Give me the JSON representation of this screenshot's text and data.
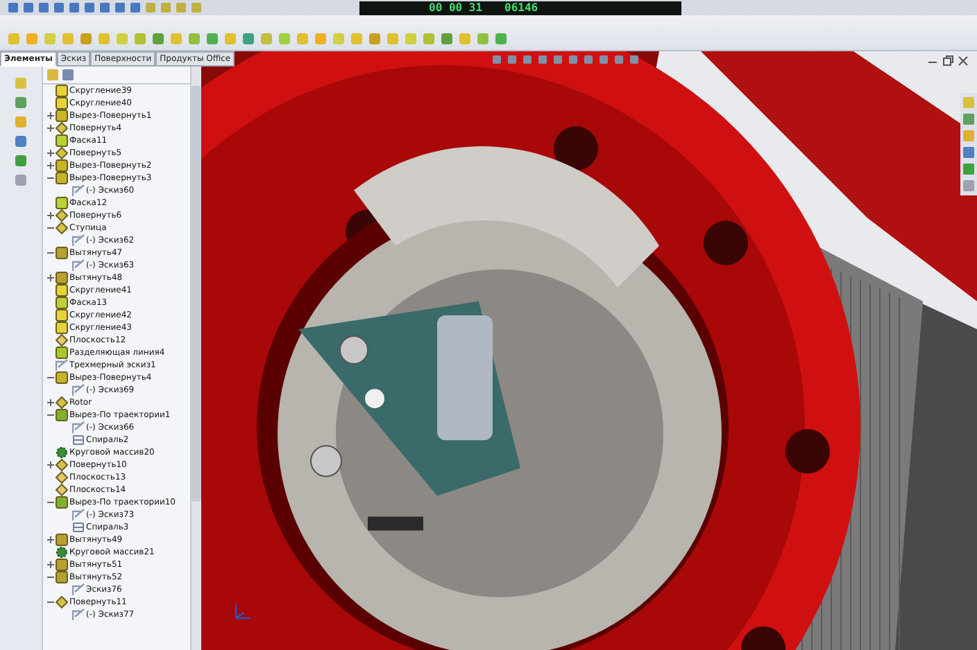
{
  "timer": {
    "time": "00 00 31",
    "count": "06146"
  },
  "tabs": [
    {
      "label": "Элементы",
      "selected": true
    },
    {
      "label": "Эскиз",
      "selected": false
    },
    {
      "label": "Поверхности",
      "selected": false
    },
    {
      "label": "Продукты Office",
      "selected": false
    }
  ],
  "tree": [
    {
      "label": "Скругление39",
      "kind": "fillet"
    },
    {
      "label": "Скругление40",
      "kind": "fillet"
    },
    {
      "label": "Вырез-Повернуть1",
      "kind": "cut",
      "expanded": false
    },
    {
      "label": "Повернуть4",
      "kind": "revolve",
      "expanded": false
    },
    {
      "label": "Фаска11",
      "kind": "chamfer"
    },
    {
      "label": "Повернуть5",
      "kind": "revolve",
      "expanded": false
    },
    {
      "label": "Вырез-Повернуть2",
      "kind": "cut",
      "expanded": false
    },
    {
      "label": "Вырез-Повернуть3",
      "kind": "cut",
      "expanded": true,
      "children": [
        {
          "label": "(-) Эскиз60",
          "kind": "sketch"
        }
      ]
    },
    {
      "label": "Фаска12",
      "kind": "chamfer"
    },
    {
      "label": "Повернуть6",
      "kind": "revolve",
      "expanded": false
    },
    {
      "label": "Ступица",
      "kind": "revolve",
      "expanded": true,
      "children": [
        {
          "label": "(-) Эскиз62",
          "kind": "sketch"
        }
      ]
    },
    {
      "label": "Вытянуть47",
      "kind": "extrude",
      "expanded": true,
      "children": [
        {
          "label": "(-) Эскиз63",
          "kind": "sketch"
        }
      ]
    },
    {
      "label": "Вытянуть48",
      "kind": "extrude",
      "expanded": false
    },
    {
      "label": "Скругление41",
      "kind": "fillet"
    },
    {
      "label": "Фаска13",
      "kind": "chamfer"
    },
    {
      "label": "Скругление42",
      "kind": "fillet"
    },
    {
      "label": "Скругление43",
      "kind": "fillet"
    },
    {
      "label": "Плоскость12",
      "kind": "plane"
    },
    {
      "label": "Разделяющая линия4",
      "kind": "split"
    },
    {
      "label": "Трехмерный эскиз1",
      "kind": "sketch"
    },
    {
      "label": "Вырез-Повернуть4",
      "kind": "cut",
      "expanded": true,
      "children": [
        {
          "label": "(-) Эскиз69",
          "kind": "sketch"
        }
      ]
    },
    {
      "label": "Rotor",
      "kind": "revolve",
      "expanded": false
    },
    {
      "label": "Вырез-По траектории1",
      "kind": "sweep",
      "expanded": true,
      "children": [
        {
          "label": "(-) Эскиз66",
          "kind": "sketch"
        },
        {
          "label": "Спираль2",
          "kind": "helix"
        }
      ]
    },
    {
      "label": "Круговой массив20",
      "kind": "pattern"
    },
    {
      "label": "Повернуть10",
      "kind": "revolve",
      "expanded": false
    },
    {
      "label": "Плоскость13",
      "kind": "plane"
    },
    {
      "label": "Плоскость14",
      "kind": "plane"
    },
    {
      "label": "Вырез-По траектории10",
      "kind": "sweep",
      "expanded": true,
      "children": [
        {
          "label": "(-) Эскиз73",
          "kind": "sketch"
        },
        {
          "label": "Спираль3",
          "kind": "helix"
        }
      ]
    },
    {
      "label": "Вытянуть49",
      "kind": "extrude",
      "expanded": false
    },
    {
      "label": "Круговой массив21",
      "kind": "pattern"
    },
    {
      "label": "Вытянуть51",
      "kind": "extrude",
      "expanded": false
    },
    {
      "label": "Вытянуть52",
      "kind": "extrude",
      "expanded": true,
      "children": [
        {
          "label": "Эскиз76",
          "kind": "sketch"
        }
      ]
    },
    {
      "label": "Повернуть11",
      "kind": "revolve",
      "expanded": true,
      "children": [
        {
          "label": "(-) Эскиз77",
          "kind": "sketch"
        }
      ]
    }
  ]
}
